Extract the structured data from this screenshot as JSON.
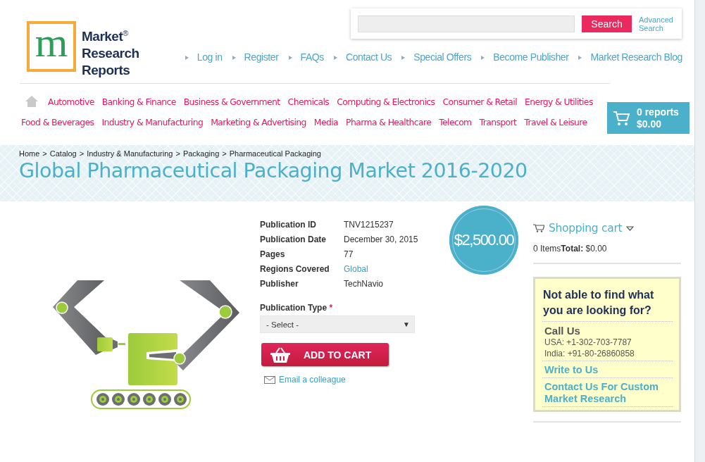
{
  "logo": {
    "letter": "m",
    "lines": [
      "Market",
      "Research",
      "Reports"
    ],
    "mark": "®"
  },
  "search": {
    "button": "Search",
    "advanced": [
      "Advanced",
      "Search"
    ]
  },
  "top_links": [
    "Log in",
    "Register",
    "FAQs",
    "Contact Us",
    "Special Offers",
    "Become Publisher",
    "Market Research Blog"
  ],
  "category_rows": [
    [
      "Automotive",
      "Banking & Finance",
      "Business & Government",
      "Chemicals",
      "Computing & Electronics",
      "Consumer & Retail",
      "Energy & Utilities"
    ],
    [
      "Food & Beverages",
      "Industry & Manufacturing",
      "Marketing & Advertising",
      "Media",
      "Pharma & Healthcare",
      "Telecom",
      "Transport",
      "Travel & Leisure"
    ]
  ],
  "cart_summary": {
    "count": "0 reports",
    "amount": "$0.00"
  },
  "breadcrumb": [
    "Home",
    "Catalog",
    "Industry & Manufacturing",
    "Packaging",
    "Pharmaceutical Packaging"
  ],
  "breadcrumb_separator": ">",
  "title": "Global Pharmaceutical Packaging Market 2016-2020",
  "details": [
    {
      "label": "Publication ID",
      "value": "TNV1215237",
      "kind": "text"
    },
    {
      "label": "Publication Date",
      "value": "December 30, 2015",
      "kind": "text"
    },
    {
      "label": "Pages",
      "value": "77",
      "kind": "text"
    },
    {
      "label": "Regions Covered",
      "value": "Global",
      "kind": "link"
    },
    {
      "label": "Publisher",
      "value": "TechNavio",
      "kind": "text"
    }
  ],
  "publication_type": {
    "label": "Publication Type",
    "required_mark": "*",
    "value": "- Select -",
    "arrow": "▼"
  },
  "add_to_cart": "ADD TO CART",
  "email_link": "Email a colleague",
  "price": "$2,500.00",
  "shopping_cart": {
    "title": "Shopping cart",
    "items": "0 Items",
    "total_label": "Total:",
    "total": "$0.00"
  },
  "help_box": {
    "heading": "Not able to find what you are looking for?",
    "call_title": "Call Us",
    "phones": [
      "USA: +1-302-703-7787",
      "India: +91-80-26860858"
    ],
    "links": [
      "Write to Us",
      "Contact Us For Custom Market Research"
    ]
  }
}
